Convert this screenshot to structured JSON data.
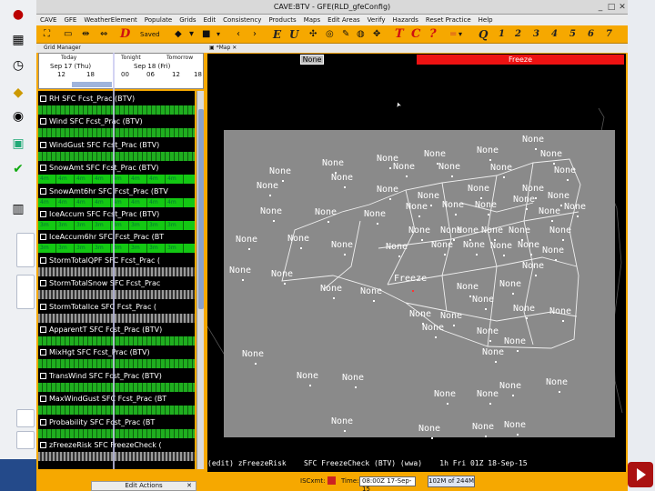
{
  "window": {
    "title": "CAVE:BTV - GFE(RLD_gfeConfig)"
  },
  "menu": [
    "CAVE",
    "GFE",
    "WeatherElement",
    "Populate",
    "Grids",
    "Edit",
    "Consistency",
    "Products",
    "Maps",
    "Edit Areas",
    "Verify",
    "Hazards",
    "Reset Practice",
    "Help"
  ],
  "toolbar": {
    "saved_label": "Saved",
    "edit_letter": "D",
    "e_letter": "E",
    "u_letter": "U",
    "t_letter": "T",
    "c_letter": "C",
    "q_letter": "?",
    "dash_label": "=",
    "q_big": "Q",
    "numbers": [
      "1",
      "2",
      "3",
      "4",
      "5",
      "6",
      "7"
    ]
  },
  "grid_manager": {
    "tab_label": "Grid Manager",
    "timeline": {
      "today": "Today",
      "tonight": "Tonight",
      "tomorrow": "Tomorrow",
      "date1": "Sep 17 (Thu)",
      "date2": "Sep 18 (Fri)",
      "hours": [
        "12",
        "18",
        "00",
        "06",
        "12",
        "18"
      ]
    },
    "rows": [
      {
        "label": "RH SFC  Fcst_Prac (BTV)",
        "bar": "striped"
      },
      {
        "label": "Wind SFC  Fcst_Prac (BTV)",
        "bar": "striped"
      },
      {
        "label": "WindGust SFC  Fcst_Prac (BTV)",
        "bar": "striped"
      },
      {
        "label": "SnowAmt SFC  Fcst_Prac (BTV)",
        "bar": "green",
        "cells": "4m"
      },
      {
        "label": "SnowAmt6hr SFC  Fcst_Prac (BTV",
        "bar": "green",
        "cells": "4m"
      },
      {
        "label": "IceAccum SFC  Fcst_Prac (BTV)",
        "bar": "green",
        "cells": "3m"
      },
      {
        "label": "IceAccum6hr SFC  Fcst_Prac (BT",
        "bar": "green",
        "cells": "3m"
      },
      {
        "label": "StormTotalQPF SFC  Fcst_Prac (",
        "bar": "gray"
      },
      {
        "label": "StormTotalSnow SFC  Fcst_Prac",
        "bar": "gray"
      },
      {
        "label": "StormTotalIce SFC  Fcst_Prac (",
        "bar": "gray"
      },
      {
        "label": "ApparentT SFC  Fcst_Prac (BTV)",
        "bar": "striped"
      },
      {
        "label": "MixHgt SFC  Fcst_Prac (BTV)",
        "bar": "striped"
      },
      {
        "label": "TransWind SFC  Fcst_Prac (BTV)",
        "bar": "striped"
      },
      {
        "label": "MaxWindGust SFC  Fcst_Prac (BT",
        "bar": "striped"
      },
      {
        "label": "Probability SFC  Fcst_Prac (BT",
        "bar": "striped"
      },
      {
        "label": "zFreezeRisk SFC  FreezeCheck (",
        "bar": "gray"
      }
    ]
  },
  "map": {
    "tab_label": "*Map",
    "legend_none": "None",
    "legend_freeze": "Freeze",
    "none_label": "None",
    "freeze_label": "Freeze",
    "status": "(edit) zFreezeRisk    SFC FreezeCheck (BTV) (wwa)    1h Fri 01Z 18-Sep-15"
  },
  "status": {
    "edit_actions": "Edit Actions",
    "isc_label": "ISCxmt:",
    "time_label": "Time:",
    "time_value": "08:00Z 17-Sep-15",
    "memory": "102M of 244M"
  }
}
